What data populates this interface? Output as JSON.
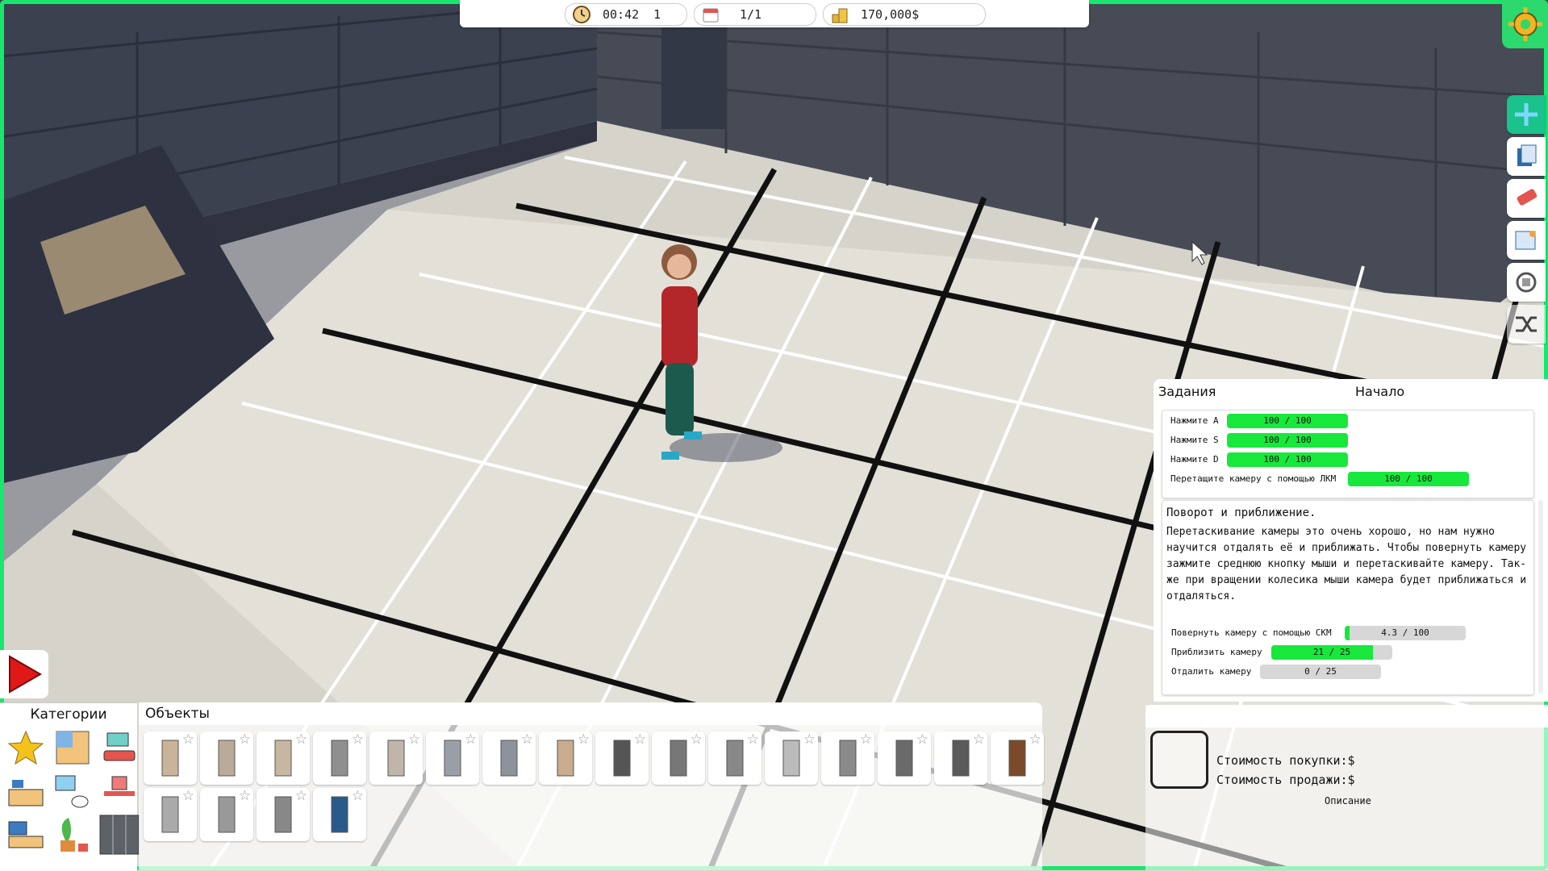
{
  "hud": {
    "time": "00:42",
    "speed": "1",
    "day": "1/1",
    "money": "170,000$"
  },
  "play_button": "play-icon",
  "right_tools": [
    "move-camera-icon",
    "documents-icon",
    "eraser-icon",
    "blueprint-icon",
    "rotate-icon",
    "shuffle-icon"
  ],
  "categories": {
    "title": "Категории",
    "items": [
      "favorites-star-icon",
      "floorplan-icon",
      "livingroom-icon",
      "kitchen-icon",
      "bathroom-icon",
      "office-icon",
      "bedroom-icon",
      "plants-icon",
      "doors-windows-icon"
    ]
  },
  "objects": {
    "title": "Объекты",
    "items": [
      "wall-icon",
      "wall-window-icon",
      "wall-window-wide-icon",
      "glass-partition-icon",
      "wall-door-frame-icon",
      "glass-panel-icon",
      "glass-wall-icon",
      "wall-doorway-icon",
      "door-frame-icon",
      "glass-door-icon",
      "glass-doorway-icon",
      "door-white-icon",
      "door-grey-icon",
      "door-dark-icon",
      "door-open-icon",
      "door-wood-icon",
      "door-slim-icon",
      "door-panel-icon",
      "door-tall-icon",
      "door-blue-icon"
    ]
  },
  "tasks": {
    "title": "Задания",
    "stage": "Начало",
    "done": [
      {
        "label": "Нажмите A",
        "value": "100 / 100",
        "fraction": 1
      },
      {
        "label": "Нажмите S",
        "value": "100 / 100",
        "fraction": 1
      },
      {
        "label": "Нажмите D",
        "value": "100 / 100",
        "fraction": 1
      },
      {
        "label": "Перетащите камеру с помощью ЛКМ",
        "value": "100 / 100",
        "fraction": 1
      }
    ],
    "current_title": "Поворот и приближение.",
    "current_text": "Перетаскивание камеры это очень хорошо, но нам нужно научится отдалять её и приближать. Чтобы повернуть камеру зажмите среднюю кнопку мыши и перетаскивайте камеру. Так-же при вращении колесика мыши камера будет приближаться и отдаляться.",
    "current": [
      {
        "label": "Повернуть камеру с помощью СКМ",
        "value": "4.3 / 100",
        "fraction": 0.043
      },
      {
        "label": "Приблизить камеру",
        "value": "21 / 25",
        "fraction": 0.84
      },
      {
        "label": "Отдалить камеру",
        "value": "0 / 25",
        "fraction": 0
      }
    ]
  },
  "info": {
    "buy_price": "Стоимость покупки:$",
    "sell_price": "Стоимость продажи:$",
    "description": "Описание"
  },
  "colors": {
    "accent": "#17e86d",
    "progress": "#18e83c",
    "tool_active": "#19c38b",
    "play": "#e01818"
  }
}
